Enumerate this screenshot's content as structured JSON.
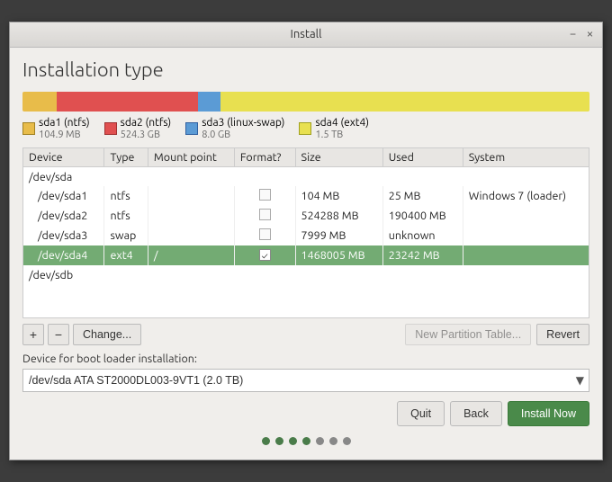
{
  "window": {
    "title": "Install",
    "minimize": "−",
    "close": "×"
  },
  "page": {
    "title": "Installation type"
  },
  "partition_bar": {
    "segments": [
      {
        "id": "sda1",
        "color": "#e8bc4a",
        "flex": 6
      },
      {
        "id": "sda2",
        "color": "#e05050",
        "flex": 25
      },
      {
        "id": "sda3",
        "color": "#5b9bd5",
        "flex": 4
      },
      {
        "id": "sda4",
        "color": "#e8e050",
        "flex": 65
      }
    ]
  },
  "legend": [
    {
      "color": "#e8bc4a",
      "border": "#a08020",
      "label": "sda1 (ntfs)",
      "sub": "104.9 MB"
    },
    {
      "color": "#e05050",
      "border": "#a03030",
      "label": "sda2 (ntfs)",
      "sub": "524.3 GB"
    },
    {
      "color": "#5b9bd5",
      "border": "#3060a0",
      "label": "sda3 (linux-swap)",
      "sub": "8.0 GB"
    },
    {
      "color": "#e8e050",
      "border": "#a0a020",
      "label": "sda4 (ext4)",
      "sub": "1.5 TB"
    }
  ],
  "table": {
    "headers": [
      "Device",
      "Type",
      "Mount point",
      "Format?",
      "Size",
      "Used",
      "System"
    ],
    "rows": [
      {
        "type": "group",
        "device": "/dev/sda",
        "cells": []
      },
      {
        "type": "data",
        "device": "/dev/sda1",
        "dtype": "ntfs",
        "mount": "",
        "format": false,
        "size": "104 MB",
        "used": "25 MB",
        "system": "Windows 7 (loader)",
        "selected": false
      },
      {
        "type": "data",
        "device": "/dev/sda2",
        "dtype": "ntfs",
        "mount": "",
        "format": false,
        "size": "524288 MB",
        "used": "190400 MB",
        "system": "",
        "selected": false
      },
      {
        "type": "data",
        "device": "/dev/sda3",
        "dtype": "swap",
        "mount": "",
        "format": false,
        "size": "7999 MB",
        "used": "unknown",
        "system": "",
        "selected": false
      },
      {
        "type": "data",
        "device": "/dev/sda4",
        "dtype": "ext4",
        "mount": "/",
        "format": true,
        "size": "1468005 MB",
        "used": "23242 MB",
        "system": "",
        "selected": true
      },
      {
        "type": "group",
        "device": "/dev/sdb",
        "cells": []
      },
      {
        "type": "empty",
        "device": "",
        "cells": []
      }
    ]
  },
  "controls": {
    "add": "+",
    "remove": "−",
    "change": "Change...",
    "new_partition_table": "New Partition Table...",
    "revert": "Revert"
  },
  "bootloader": {
    "label": "Device for boot loader installation:",
    "value": "/dev/sda   ATA ST2000DL003-9VT1 (2.0 TB)"
  },
  "actions": {
    "quit": "Quit",
    "back": "Back",
    "install_now": "Install Now"
  },
  "dots": [
    {
      "active": true
    },
    {
      "active": true
    },
    {
      "active": true
    },
    {
      "active": true
    },
    {
      "active": false
    },
    {
      "active": false
    },
    {
      "active": false
    }
  ]
}
